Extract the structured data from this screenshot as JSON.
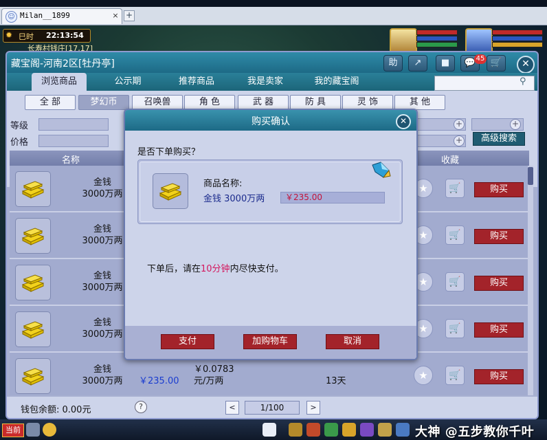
{
  "browser": {
    "tab_title": "Milan__1899",
    "tab_close": "×",
    "add_tab": "+"
  },
  "hud": {
    "period": "巳时",
    "time": "22:13:54",
    "location": "长寿村钱庄[17,17]"
  },
  "shop": {
    "title": "藏宝阁-河南2区[牡丹亭]",
    "header_buttons": [
      "助",
      "↗",
      "■",
      "💬",
      "🛒"
    ],
    "cart_count": "45",
    "close": "✕",
    "nav_tabs": [
      "浏览商品",
      "公示期",
      "推荐商品",
      "我是卖家",
      "我的藏宝阁"
    ],
    "active_tab": 0,
    "search_placeholder": "",
    "categories": [
      "全 部",
      "梦幻币",
      "召唤兽",
      "角 色",
      "武 器",
      "防 具",
      "灵 饰",
      "其 他"
    ],
    "active_category": 1,
    "filter_level_label": "等级",
    "filter_price_label": "价格",
    "advanced_search": "高级搜索",
    "column_name": "名称",
    "column_favorite": "收藏",
    "rows": [
      {
        "name": "金钱",
        "amount": "3000万两",
        "price": "",
        "unit_price": "",
        "unit": "",
        "time": "",
        "buy": "购买"
      },
      {
        "name": "金钱",
        "amount": "3000万两",
        "price": "",
        "unit_price": "",
        "unit": "",
        "time": "",
        "buy": "购买"
      },
      {
        "name": "金钱",
        "amount": "3000万两",
        "price": "",
        "unit_price": "",
        "unit": "",
        "time": "",
        "buy": "购买"
      },
      {
        "name": "金钱",
        "amount": "3000万两",
        "price": "",
        "unit_price": "",
        "unit": "",
        "time": "",
        "buy": "购买"
      },
      {
        "name": "金钱",
        "amount": "3000万两",
        "price": "￥235.00",
        "unit_price": "￥0.0783",
        "unit": "元/万两",
        "time": "13天",
        "buy": "购买"
      }
    ],
    "wallet": "钱包余额: 0.00元",
    "help": "?",
    "prev_page": "<",
    "next_page": ">",
    "page_indicator": "1/100"
  },
  "modal": {
    "title": "购买确认",
    "close": "✕",
    "question": "是否下单购买？",
    "item_label": "商品名称:",
    "item_name": "金钱  3000万两",
    "item_price": "￥235.00",
    "note_before": "下单后，请在",
    "note_highlight": "10分钟",
    "note_after": "内尽快支付。",
    "buttons": [
      "支付",
      "加购物车",
      "取消"
    ]
  },
  "bottom_bar": {
    "current": "当前",
    "watermark": "大神 @五步教你千叶"
  },
  "colors": {
    "header_teal": "#1d6a86",
    "panel": "#cdd4ea",
    "buy_red": "#a3232a",
    "price_blue": "#1a3cd0",
    "price_red": "#c2143a",
    "highlight_pink": "#d4165d"
  },
  "icons": {
    "clock": "sun-icon",
    "search": "magnifier-icon",
    "favorite": "star-icon",
    "cart": "cart-icon",
    "gold": "gold-ingot-icon",
    "gem": "gem-icon"
  }
}
